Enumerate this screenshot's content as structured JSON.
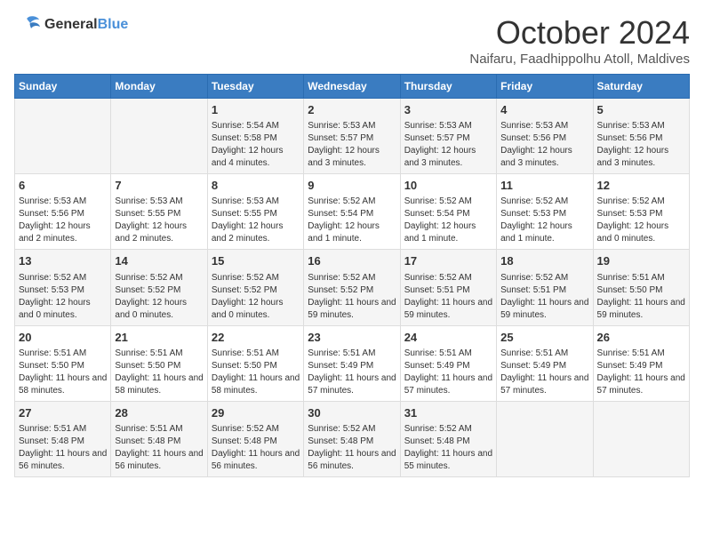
{
  "header": {
    "logo_line1": "General",
    "logo_line2": "Blue",
    "month": "October 2024",
    "location": "Naifaru, Faadhippolhu Atoll, Maldives"
  },
  "weekdays": [
    "Sunday",
    "Monday",
    "Tuesday",
    "Wednesday",
    "Thursday",
    "Friday",
    "Saturday"
  ],
  "weeks": [
    [
      {
        "day": "",
        "info": ""
      },
      {
        "day": "",
        "info": ""
      },
      {
        "day": "1",
        "info": "Sunrise: 5:54 AM\nSunset: 5:58 PM\nDaylight: 12 hours and 4 minutes."
      },
      {
        "day": "2",
        "info": "Sunrise: 5:53 AM\nSunset: 5:57 PM\nDaylight: 12 hours and 3 minutes."
      },
      {
        "day": "3",
        "info": "Sunrise: 5:53 AM\nSunset: 5:57 PM\nDaylight: 12 hours and 3 minutes."
      },
      {
        "day": "4",
        "info": "Sunrise: 5:53 AM\nSunset: 5:56 PM\nDaylight: 12 hours and 3 minutes."
      },
      {
        "day": "5",
        "info": "Sunrise: 5:53 AM\nSunset: 5:56 PM\nDaylight: 12 hours and 3 minutes."
      }
    ],
    [
      {
        "day": "6",
        "info": "Sunrise: 5:53 AM\nSunset: 5:56 PM\nDaylight: 12 hours and 2 minutes."
      },
      {
        "day": "7",
        "info": "Sunrise: 5:53 AM\nSunset: 5:55 PM\nDaylight: 12 hours and 2 minutes."
      },
      {
        "day": "8",
        "info": "Sunrise: 5:53 AM\nSunset: 5:55 PM\nDaylight: 12 hours and 2 minutes."
      },
      {
        "day": "9",
        "info": "Sunrise: 5:52 AM\nSunset: 5:54 PM\nDaylight: 12 hours and 1 minute."
      },
      {
        "day": "10",
        "info": "Sunrise: 5:52 AM\nSunset: 5:54 PM\nDaylight: 12 hours and 1 minute."
      },
      {
        "day": "11",
        "info": "Sunrise: 5:52 AM\nSunset: 5:53 PM\nDaylight: 12 hours and 1 minute."
      },
      {
        "day": "12",
        "info": "Sunrise: 5:52 AM\nSunset: 5:53 PM\nDaylight: 12 hours and 0 minutes."
      }
    ],
    [
      {
        "day": "13",
        "info": "Sunrise: 5:52 AM\nSunset: 5:53 PM\nDaylight: 12 hours and 0 minutes."
      },
      {
        "day": "14",
        "info": "Sunrise: 5:52 AM\nSunset: 5:52 PM\nDaylight: 12 hours and 0 minutes."
      },
      {
        "day": "15",
        "info": "Sunrise: 5:52 AM\nSunset: 5:52 PM\nDaylight: 12 hours and 0 minutes."
      },
      {
        "day": "16",
        "info": "Sunrise: 5:52 AM\nSunset: 5:52 PM\nDaylight: 11 hours and 59 minutes."
      },
      {
        "day": "17",
        "info": "Sunrise: 5:52 AM\nSunset: 5:51 PM\nDaylight: 11 hours and 59 minutes."
      },
      {
        "day": "18",
        "info": "Sunrise: 5:52 AM\nSunset: 5:51 PM\nDaylight: 11 hours and 59 minutes."
      },
      {
        "day": "19",
        "info": "Sunrise: 5:51 AM\nSunset: 5:50 PM\nDaylight: 11 hours and 59 minutes."
      }
    ],
    [
      {
        "day": "20",
        "info": "Sunrise: 5:51 AM\nSunset: 5:50 PM\nDaylight: 11 hours and 58 minutes."
      },
      {
        "day": "21",
        "info": "Sunrise: 5:51 AM\nSunset: 5:50 PM\nDaylight: 11 hours and 58 minutes."
      },
      {
        "day": "22",
        "info": "Sunrise: 5:51 AM\nSunset: 5:50 PM\nDaylight: 11 hours and 58 minutes."
      },
      {
        "day": "23",
        "info": "Sunrise: 5:51 AM\nSunset: 5:49 PM\nDaylight: 11 hours and 57 minutes."
      },
      {
        "day": "24",
        "info": "Sunrise: 5:51 AM\nSunset: 5:49 PM\nDaylight: 11 hours and 57 minutes."
      },
      {
        "day": "25",
        "info": "Sunrise: 5:51 AM\nSunset: 5:49 PM\nDaylight: 11 hours and 57 minutes."
      },
      {
        "day": "26",
        "info": "Sunrise: 5:51 AM\nSunset: 5:49 PM\nDaylight: 11 hours and 57 minutes."
      }
    ],
    [
      {
        "day": "27",
        "info": "Sunrise: 5:51 AM\nSunset: 5:48 PM\nDaylight: 11 hours and 56 minutes."
      },
      {
        "day": "28",
        "info": "Sunrise: 5:51 AM\nSunset: 5:48 PM\nDaylight: 11 hours and 56 minutes."
      },
      {
        "day": "29",
        "info": "Sunrise: 5:52 AM\nSunset: 5:48 PM\nDaylight: 11 hours and 56 minutes."
      },
      {
        "day": "30",
        "info": "Sunrise: 5:52 AM\nSunset: 5:48 PM\nDaylight: 11 hours and 56 minutes."
      },
      {
        "day": "31",
        "info": "Sunrise: 5:52 AM\nSunset: 5:48 PM\nDaylight: 11 hours and 55 minutes."
      },
      {
        "day": "",
        "info": ""
      },
      {
        "day": "",
        "info": ""
      }
    ]
  ]
}
